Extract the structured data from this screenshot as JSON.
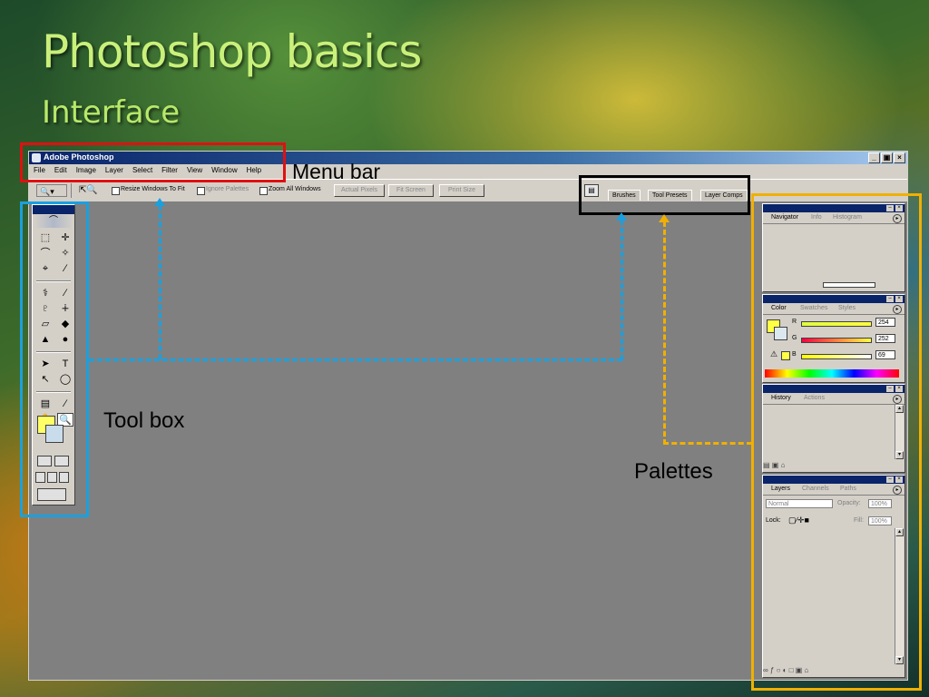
{
  "slide": {
    "title": "Photoshop basics",
    "subtitle": "Interface"
  },
  "window": {
    "title": "Adobe Photoshop",
    "buttons": [
      "_",
      "▣",
      "×"
    ]
  },
  "menu": [
    "File",
    "Edit",
    "Image",
    "Layer",
    "Select",
    "Filter",
    "View",
    "Window",
    "Help"
  ],
  "options_bar": {
    "tool_icon": "zoom-icon",
    "resize_label": "Resize Windows To Fit",
    "ignore_label": "Ignore Palettes",
    "zoom_all_label": "Zoom All Windows",
    "actual_pixels": "Actual Pixels",
    "fit_screen": "Fit Screen",
    "print_size": "Print Size"
  },
  "palette_well": {
    "tabs": [
      "Brushes",
      "Tool Presets",
      "Layer Comps"
    ]
  },
  "palettes": {
    "navigator": {
      "tabs": [
        "Navigator",
        "Info",
        "Histogram"
      ]
    },
    "color": {
      "tabs": [
        "Color",
        "Swatches",
        "Styles"
      ],
      "channels": [
        {
          "label": "R",
          "value": "254"
        },
        {
          "label": "G",
          "value": "252"
        },
        {
          "label": "B",
          "value": "69"
        }
      ],
      "foreground": "#ffff45"
    },
    "history": {
      "tabs": [
        "History",
        "Actions"
      ]
    },
    "layers": {
      "tabs": [
        "Layers",
        "Channels",
        "Paths"
      ],
      "blend_mode": "Normal",
      "opacity_label": "Opacity:",
      "opacity_value": "100%",
      "lock_label": "Lock:",
      "fill_label": "Fill:",
      "fill_value": "100%"
    }
  },
  "callouts": {
    "menu_bar": "Menu bar",
    "tool_box": "Tool box",
    "palettes": "Palettes"
  },
  "colors": {
    "title": "#c9f07a",
    "highlight_red": "#e01010",
    "highlight_blue": "#1aa0e0",
    "highlight_gold": "#f0b000"
  }
}
